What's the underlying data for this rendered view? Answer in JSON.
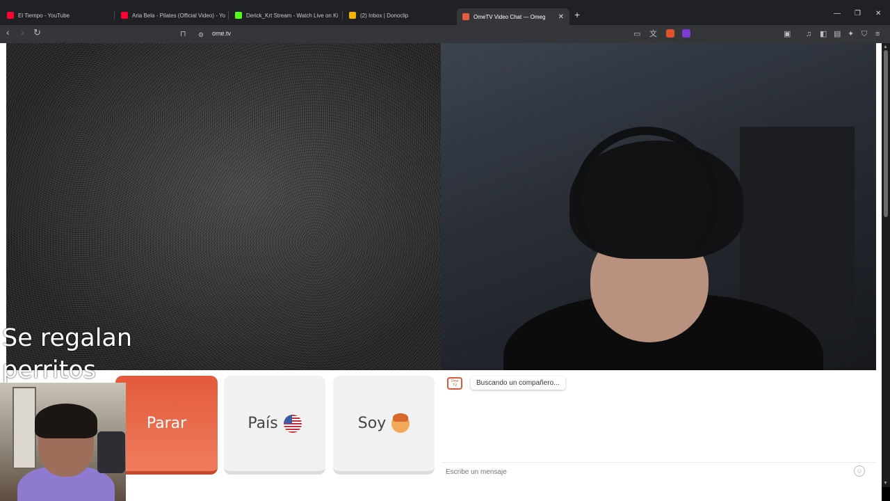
{
  "browser": {
    "tabs": [
      {
        "title": "El Tiempo - YouTube",
        "icon": "youtube-icon",
        "color": "#ff0033"
      },
      {
        "title": "Aria Bela - Pilates (Official Video) - Yo",
        "icon": "youtube-icon",
        "color": "#ff0033"
      },
      {
        "title": "Derick_Krt Stream - Watch Live on Ki",
        "icon": "kick-icon",
        "color": "#53fc18"
      },
      {
        "title": "(2) Inbox | Donoclip",
        "icon": "donoclip-icon",
        "color": "#f4b400"
      },
      {
        "title": "OmeTV Video Chat — Omeg",
        "icon": "ometv-icon",
        "color": "#e35a3c",
        "active": true
      }
    ],
    "url": "ome.tv"
  },
  "stream_overlay": {
    "text_line1": "Se regalan",
    "text_line2": "perritos"
  },
  "controls": {
    "stop_label": "Parar",
    "country_label": "País",
    "country_flag": "us-flag-icon",
    "gender_label": "Soy",
    "gender_icon": "boy-emoji-icon",
    "accent": "#e35a3c"
  },
  "chat": {
    "logo_text": "Ome TV",
    "status_message": "Buscando un compañero...",
    "input_placeholder": "Escribe un mensaje"
  }
}
